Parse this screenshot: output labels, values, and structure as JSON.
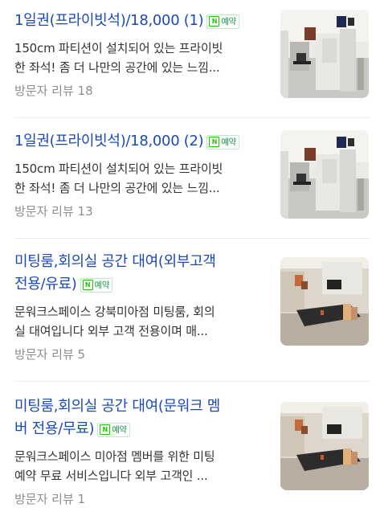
{
  "results": [
    {
      "title": "1일권(프라이빗석)/18,000 (1)",
      "badge": "예약",
      "desc_lines": [
        "150cm 파티션이 설치되어 있는 프라이빗",
        "한 좌석! 좀 더 나만의 공간에 있는 느낌..."
      ],
      "reviews": "방문자 리뷰 18",
      "image_kind": "partition"
    },
    {
      "title": "1일권(프라이빗석)/18,000 (2)",
      "badge": "예약",
      "desc_lines": [
        "150cm 파티션이 설치되어 있는 프라이빗",
        "한 좌석! 좀 더 나만의 공간에 있는 느낌..."
      ],
      "reviews": "방문자 리뷰 13",
      "image_kind": "partition"
    },
    {
      "title_lines": [
        "미팅룸,회의실 공간 대여(외부고객",
        "전용/유료)"
      ],
      "badge": "예약",
      "desc_lines": [
        "문워크스페이스 강북미아점 미팅룸, 회의",
        "실 대여입니다 외부 고객 전용이며 매..."
      ],
      "reviews": "방문자 리뷰 5",
      "image_kind": "meeting-room"
    },
    {
      "title_lines": [
        "미팅룸,회의실 공간 대여(문워크 멤",
        "버 전용/무료)"
      ],
      "badge": "예약",
      "desc_lines": [
        "문워크스페이스 미아점 멤버를 위한 미팅",
        "예약 무료 서비스입니다 외부 고객인 ..."
      ],
      "reviews": "방문자 리뷰 1",
      "image_kind": "meeting-room"
    }
  ],
  "badge_icon": "naver-n-icon",
  "colors": {
    "title": "#1b4ab8",
    "badge_green": "#119a43",
    "text": "#333333",
    "muted": "#8e8e8e"
  }
}
